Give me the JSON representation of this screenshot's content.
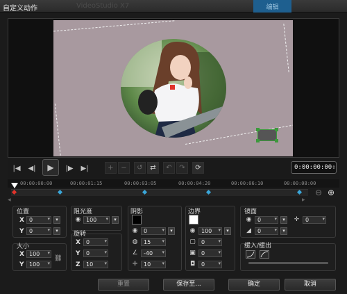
{
  "window": {
    "title": "自定义动作",
    "ghost_title": "VideoStudio X7",
    "tab_label": "编辑"
  },
  "transport": {
    "timecode": "0:00:00:00",
    "timecode_icon": "spinner-icon"
  },
  "timeline": {
    "labels": [
      "00:00:00:00",
      "00:00:01:15",
      "00:00:03:05",
      "00:00:04:20",
      "00:00:06:10",
      "00:00:08:00"
    ],
    "zoom_out_icon": "zoom-out-icon",
    "zoom_in_icon": "zoom-in-icon"
  },
  "position": {
    "label": "位置",
    "x": "0",
    "y": "0"
  },
  "size": {
    "label": "大小",
    "x": "100",
    "y": "100"
  },
  "opacity": {
    "label": "阻光度",
    "value": "100"
  },
  "rotation": {
    "label": "旋转",
    "x": "0",
    "y": "0",
    "z": "10"
  },
  "shadow": {
    "label": "阴影",
    "color": "#000000",
    "opacity": "0",
    "blur": "15",
    "angle": "-40",
    "distance": "10"
  },
  "border": {
    "label": "边界",
    "color": "#ffffff",
    "opacity": "100",
    "width": "0",
    "v2": "0",
    "v3": "0"
  },
  "mirror": {
    "label": "镜面",
    "v1": "0",
    "v2": "0",
    "v3": "0"
  },
  "fade": {
    "label": "缓入/缓出"
  },
  "buttons": {
    "reset": "重置",
    "save_to": "保存至...",
    "ok": "确定",
    "cancel": "取消"
  },
  "colors": {
    "canvas": "#a8999f",
    "accent": "#3aa6d8",
    "keyframe_start": "#e0332b"
  }
}
